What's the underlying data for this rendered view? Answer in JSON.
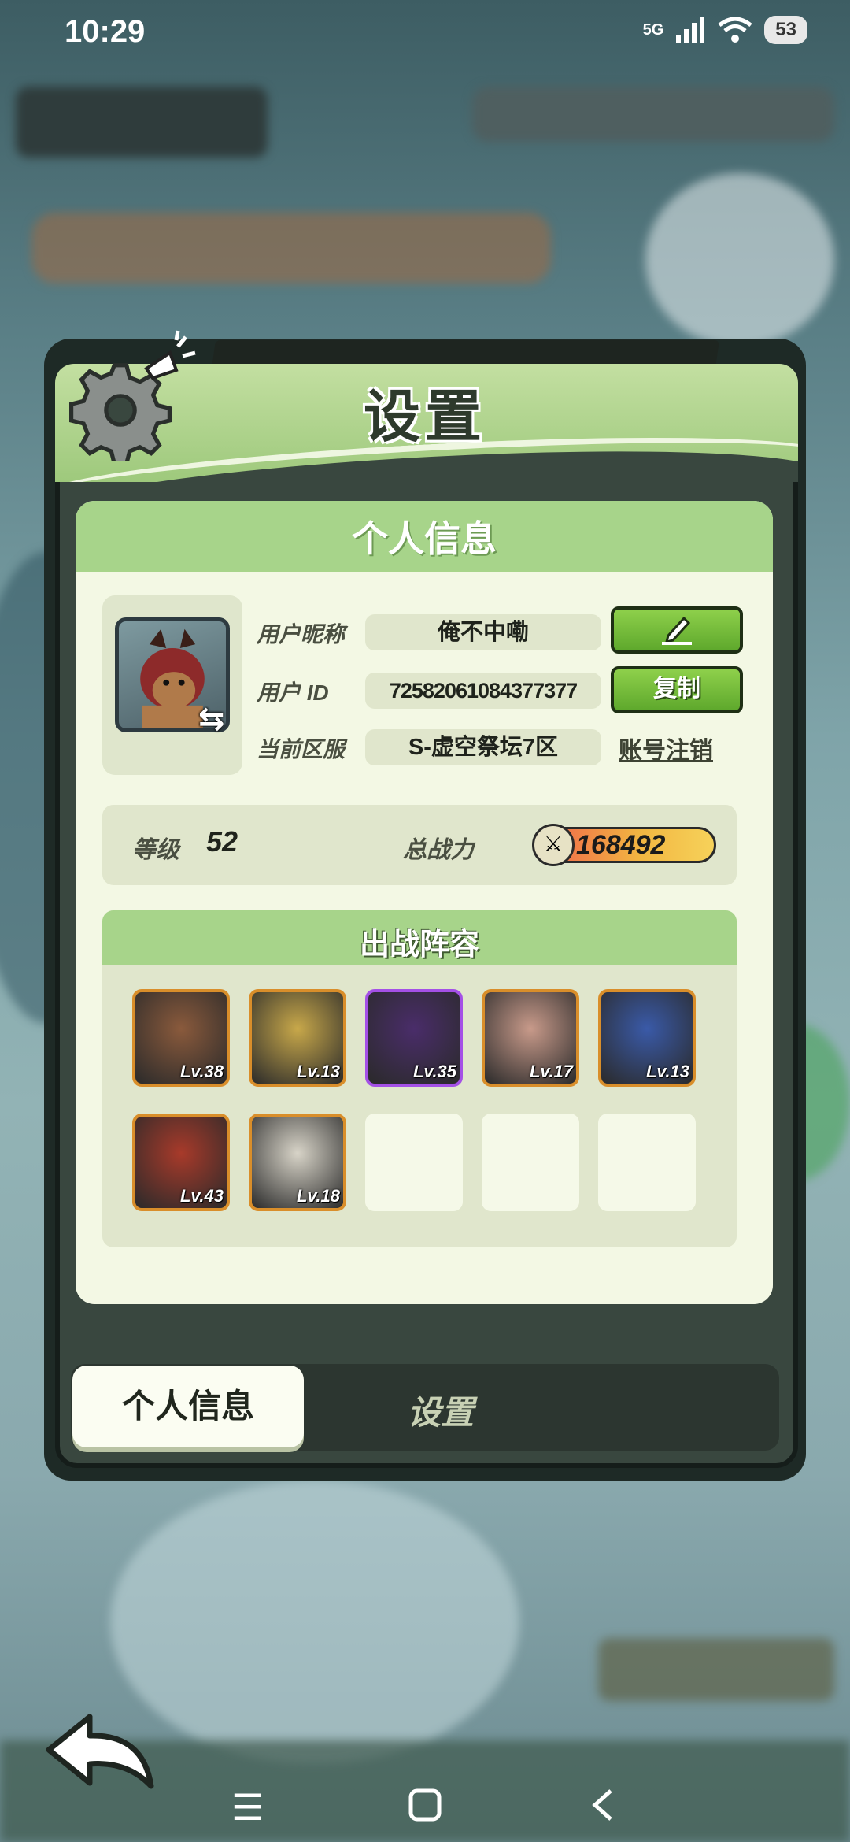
{
  "status": {
    "time": "10:29",
    "network": "5G",
    "battery": "53"
  },
  "title": "设置",
  "panel": {
    "heading": "个人信息",
    "nickname_label": "用户昵称",
    "nickname": "俺不中嘞",
    "uid_label": "用户 ID",
    "uid": "72582061084377377",
    "copy_button": "复制",
    "server_label": "当前区服",
    "server": "S-虚空祭坛7区",
    "cancel_account": "账号注销",
    "level_label": "等级",
    "level": "52",
    "power_label": "总战力",
    "power": "168492",
    "lineup_heading": "出战阵容",
    "heroes": [
      {
        "level": "Lv.38",
        "color": "#8a5a3c"
      },
      {
        "level": "Lv.13",
        "color": "#c8a84a"
      },
      {
        "level": "Lv.35",
        "color": "#4a2d6a"
      },
      {
        "level": "Lv.17",
        "color": "#c89a8a"
      },
      {
        "level": "Lv.13",
        "color": "#3a5aa8"
      },
      {
        "level": "Lv.43",
        "color": "#a83a2a"
      },
      {
        "level": "Lv.18",
        "color": "#d8d4c8"
      }
    ]
  },
  "tabs": {
    "active": "个人信息",
    "inactive": "设置"
  },
  "colors": {
    "accent_green": "#a7d48a",
    "button_green": "#6fbd35",
    "panel_bg": "#f3f8e4"
  }
}
